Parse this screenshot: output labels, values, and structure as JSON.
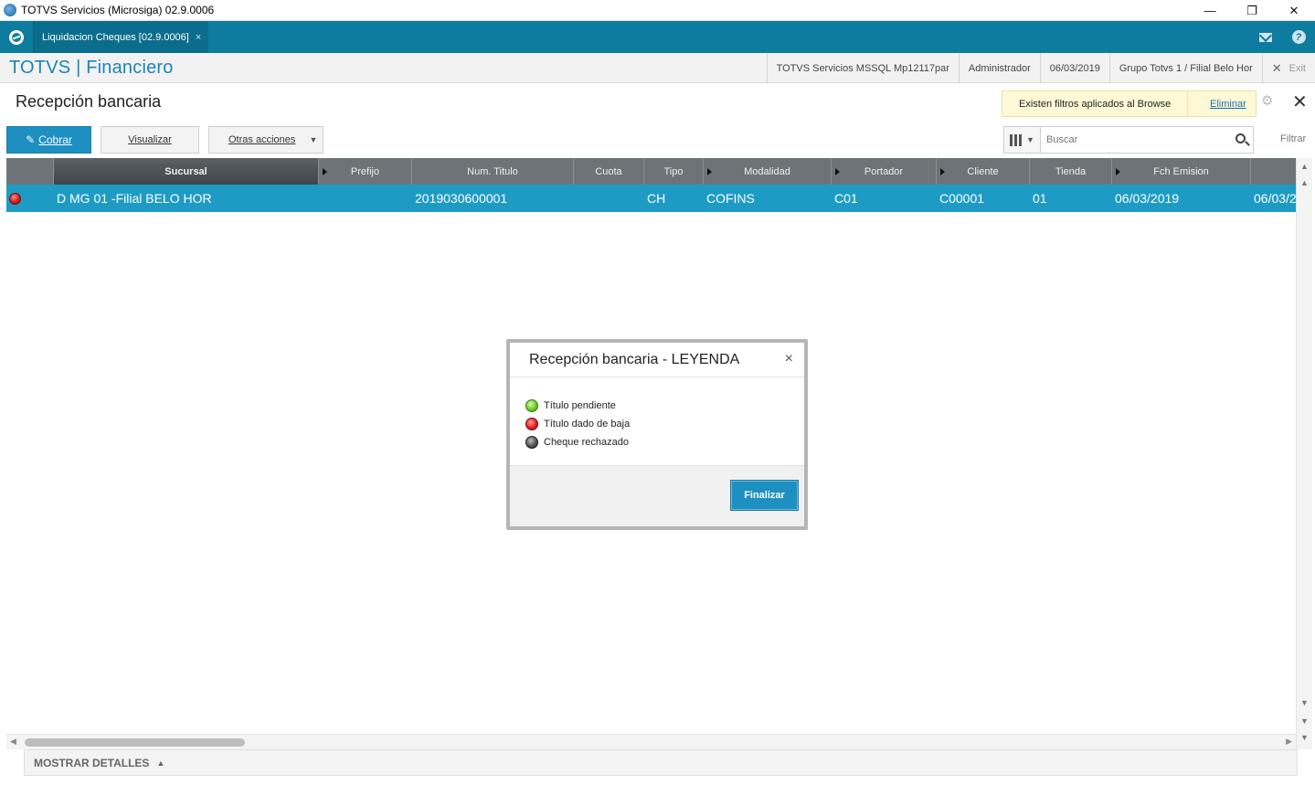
{
  "window": {
    "title": "TOTVS Servicios (Microsiga) 02.9.0006",
    "controls": {
      "minimize": "—",
      "restore": "❐",
      "close": "✕"
    }
  },
  "tabbar": {
    "active_tab": "Liquidacion Cheques [02.9.0006]",
    "tab_close": "×"
  },
  "module": {
    "title": "TOTVS | Financiero",
    "environment": "TOTVS Servicios MSSQL Mp12117par",
    "user": "Administrador",
    "date": "06/03/2019",
    "branch": "Grupo Totvs 1 / Filial Belo Hor",
    "exit_label": "Exit"
  },
  "page": {
    "title": "Recepción bancaria",
    "filter_notice": "Existen filtros aplicados al Browse",
    "filter_remove": "Eliminar"
  },
  "toolbar": {
    "cobrar": "Cobrar",
    "visualizar": "Visualizar",
    "otras_acciones": "Otras acciones",
    "search_placeholder": "Buscar",
    "filtrar": "Filtrar"
  },
  "grid": {
    "columns": [
      "Sucursal",
      "Prefijo",
      "Num. Titulo",
      "Cuota",
      "Tipo",
      "Modalidad",
      "Portador",
      "Cliente",
      "Tienda",
      "Fch Emision"
    ],
    "rows": [
      {
        "status": "red",
        "sucursal": "D MG 01 -Filial BELO HOR",
        "prefijo": "",
        "num_titulo": "2019030600001",
        "cuota": "",
        "tipo": "CH",
        "modalidad": "COFINS",
        "portador": "C01",
        "cliente": "C00001",
        "tienda": "01",
        "fch_emision": "06/03/2019",
        "extra": "06/03/2"
      }
    ]
  },
  "details": {
    "label": "MOSTRAR DETALLES"
  },
  "modal": {
    "title": "Recepción bancaria - LEYENDA",
    "close": "×",
    "legend": [
      {
        "color": "green",
        "label": "Título pendiente"
      },
      {
        "color": "red",
        "label": "Título dado de baja"
      },
      {
        "color": "gray",
        "label": "Cheque rechazado"
      }
    ],
    "button": "Finalizar"
  }
}
